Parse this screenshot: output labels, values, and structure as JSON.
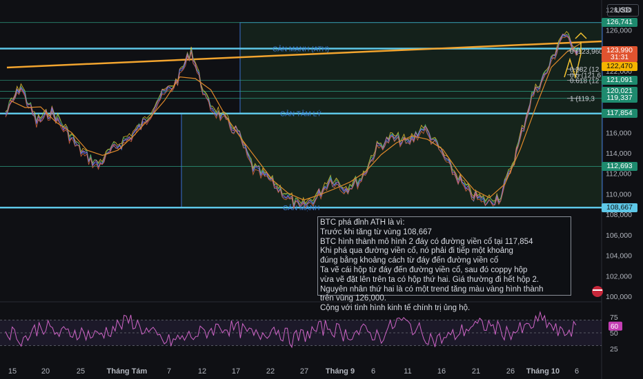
{
  "currency_label": "USD",
  "price_axis": {
    "ticks": [
      128000,
      126000,
      124000,
      122000,
      120000,
      118000,
      116000,
      114000,
      112000,
      110000,
      108000,
      106000,
      104000,
      102000,
      100000
    ],
    "tick_labels": [
      "128,000",
      "126,000",
      "124,000",
      "122,000",
      "120,000",
      "118,000",
      "116,000",
      "114,000",
      "112,000",
      "110,000",
      "108,000",
      "106,000",
      "104,000",
      "102,000",
      "100,000"
    ]
  },
  "time_axis": {
    "labels": [
      "15",
      "20",
      "25",
      "Tháng Tám",
      "7",
      "12",
      "17",
      "22",
      "27",
      "Tháng 9",
      "6",
      "11",
      "16",
      "21",
      "26",
      "Tháng 10",
      "6"
    ]
  },
  "rsi_axis": {
    "ticks": [
      75,
      50,
      25
    ],
    "tick_labels": [
      "75",
      "50",
      "25"
    ],
    "current": "60"
  },
  "levels": [
    {
      "label": "CẢN MẠNH (ATH)",
      "price": 124200,
      "color": "#5ec8e8"
    },
    {
      "label": "CẢN TÂM LÝ",
      "price": 117854,
      "color": "#5ec8e8"
    },
    {
      "label": "CẢN MẠNH",
      "price": 108667,
      "color": "#5ec8e8"
    }
  ],
  "price_tags": [
    {
      "text": "126,741",
      "price": 126741,
      "color": "#1e8a6e"
    },
    {
      "text": "123,990",
      "price": 123990,
      "color": "#e0532f"
    },
    {
      "text": "31:31",
      "price": 123300,
      "color": "#e0532f"
    },
    {
      "text": "122,470",
      "price": 122470,
      "color": "#f5b400"
    },
    {
      "text": "121,091",
      "price": 121091,
      "color": "#1e8a6e"
    },
    {
      "text": "120,021",
      "price": 120021,
      "color": "#1e8a6e"
    },
    {
      "text": "119,337",
      "price": 119337,
      "color": "#1e8a6e"
    },
    {
      "text": "117,854",
      "price": 117854,
      "color": "#1e8a6e"
    },
    {
      "text": "112,693",
      "price": 112693,
      "color": "#1e8a6e"
    },
    {
      "text": "108,667",
      "price": 108667,
      "color": "#5ec8e8"
    }
  ],
  "fib_labels": [
    {
      "text": "0 (123,960)",
      "price": 123960
    },
    {
      "text": "0.382 (12",
      "price": 122200
    },
    {
      "text": "0.5 (121,6",
      "price": 121650
    },
    {
      "text": "0.618 (12",
      "price": 121100
    },
    {
      "text": "1 (119,3",
      "price": 119340
    }
  ],
  "note": {
    "lines": [
      "BTC phá đỉnh ATH là vì:",
      "Trước khi tăng từ vùng 108,667",
      "BTC hình thành mô hình 2 đáy có đường viền cổ tại 117,854",
      "Khi phá qua đường viền cổ, nó phải đi tiếp một khoảng",
      "đúng bằng khoảng cách từ đáy đến đường viền cổ",
      "Ta vẽ cái hộp từ đáy đến đường viền cổ, sau đó coppy hộp",
      "vừa vẽ đặt lên trên ta có hộp thứ hai. Giá thường đi hết hộp 2.",
      "Nguyên nhân thứ hai là có một trend tăng màu vàng hình thành",
      "trên vùng 126,000.",
      "Cộng với tình hình kinh tế chính trị ủng hộ."
    ]
  },
  "chart_data": {
    "type": "line",
    "title": "",
    "xlabel": "",
    "ylabel": "",
    "ylim": [
      99000,
      129000
    ],
    "x": [
      "15",
      "20",
      "25",
      "Tháng Tám",
      "7",
      "12",
      "17",
      "22",
      "27",
      "Tháng 9",
      "6",
      "11",
      "16",
      "21",
      "26",
      "Tháng 10",
      "6"
    ],
    "series": [
      {
        "values": [
          117800,
          120500,
          117000,
          118000,
          116000,
          114000,
          112800,
          114500,
          115500,
          117000,
          119500,
          120800,
          124000,
          119000,
          117500,
          116000,
          112500,
          111500,
          110000,
          108700,
          109500,
          111500,
          110500,
          111500,
          114500,
          115500,
          115000,
          116500,
          114500,
          112000,
          110000,
          109200,
          109700,
          114000,
          119500,
          122000,
          125600,
          124000
        ]
      }
    ],
    "rsi": [
      55,
      40,
      62,
      48,
      52,
      45,
      57,
      70,
      50,
      35,
      42,
      50,
      60,
      55,
      45,
      58,
      40,
      50,
      60,
      48,
      52,
      45,
      70,
      55,
      38,
      45,
      60,
      62,
      50,
      55,
      72,
      48,
      60
    ]
  }
}
